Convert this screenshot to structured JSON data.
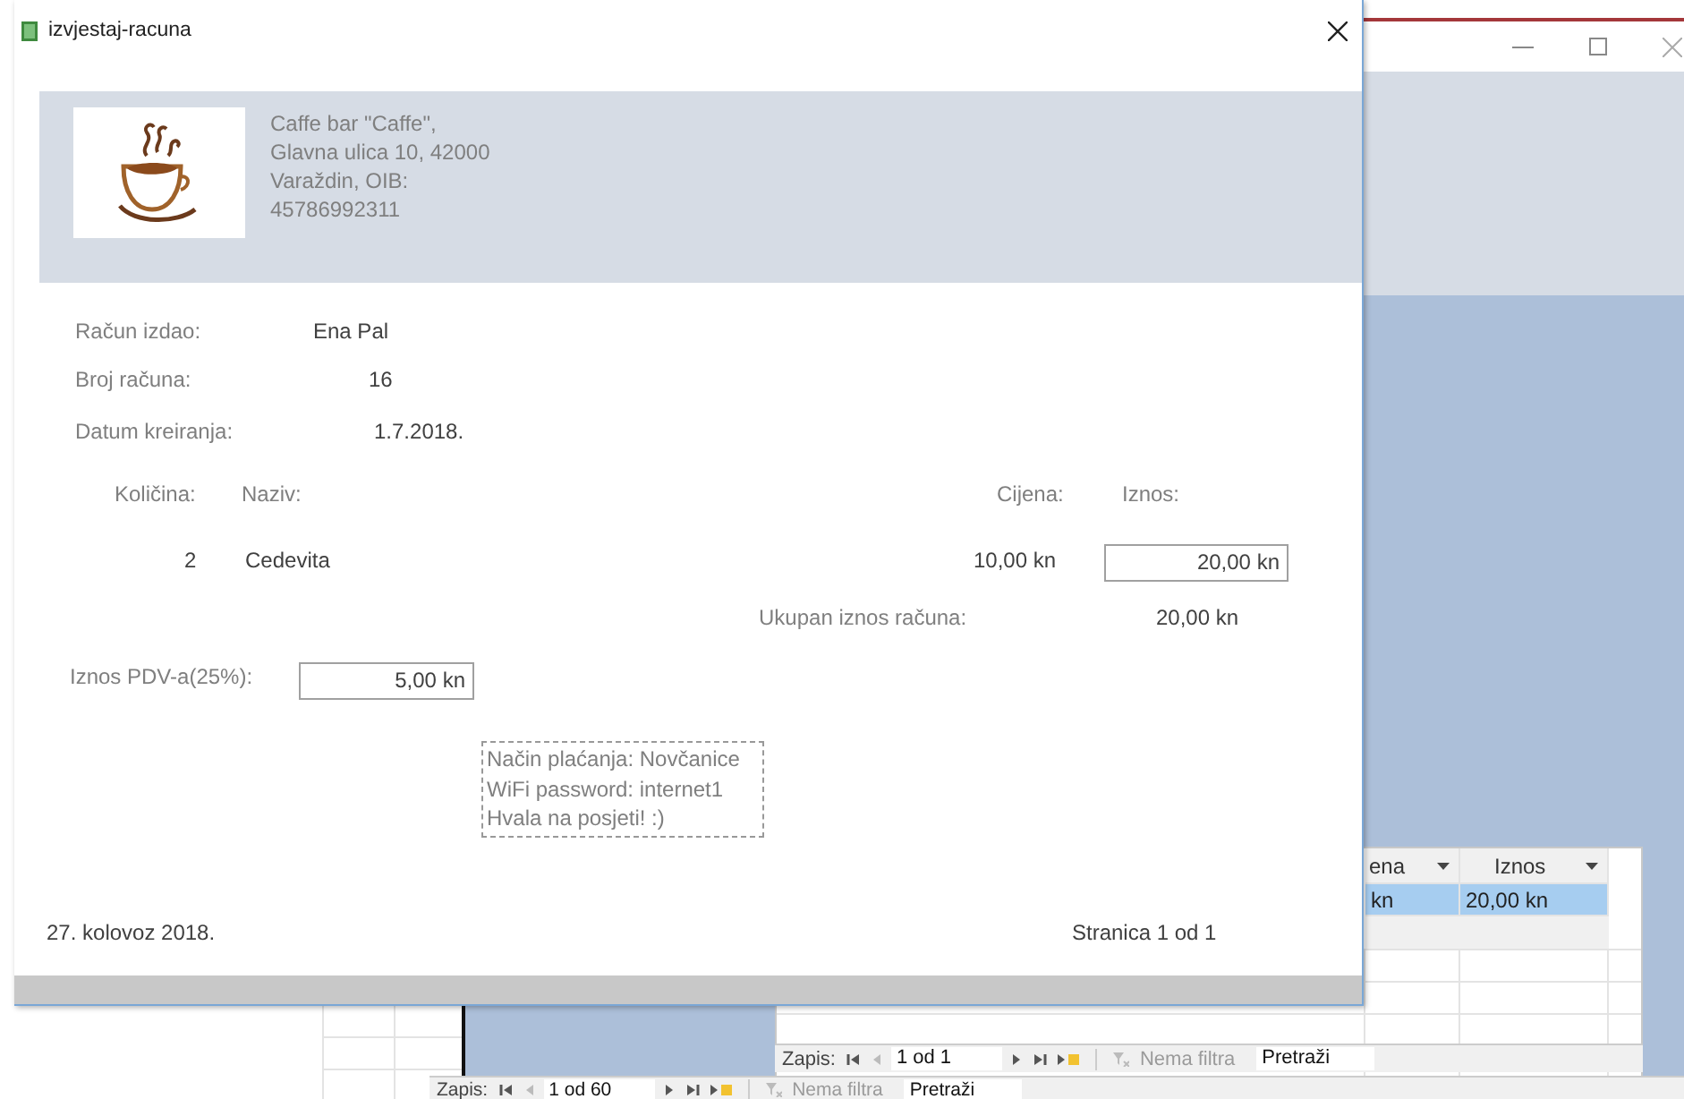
{
  "report": {
    "title": "izvjestaj-racuna",
    "company_lines": [
      "Caffe bar \"Caffe\",",
      "Glavna ulica 10, 42000",
      "Varaždin, OIB:",
      "45786992311"
    ],
    "fields": [
      {
        "label": "Račun izdao:",
        "value": "Ena Pal"
      },
      {
        "label": "Broj računa:",
        "value": "16"
      },
      {
        "label": "Datum kreiranja:",
        "value": "1.7.2018."
      }
    ],
    "columns": [
      "Količina:",
      "Naziv:",
      "Cijena:",
      "Iznos:"
    ],
    "items": [
      {
        "quantity": "2",
        "name": "Cedevita",
        "price": "10,00 kn",
        "amount": "20,00 kn"
      }
    ],
    "total": {
      "label": "Ukupan iznos računa:",
      "value": "20,00 kn"
    },
    "vat": {
      "label": "Iznos PDV-a(25%):",
      "value": "5,00 kn"
    },
    "note_lines": [
      "Način plaćanja: Novčanice",
      "WiFi password: internet1",
      "Hvala na posjeti! :)"
    ],
    "date": "27. kolovoz 2018.",
    "page": "Stranica 1 od 1"
  },
  "background_form": {
    "datasheet": {
      "columns": [
        "ena",
        "Iznos"
      ],
      "rows": [
        {
          "cells": [
            "kn",
            "20,00 kn"
          ],
          "selected": true
        }
      ]
    },
    "subform_nav": {
      "label": "Zapis:",
      "position": "1 od 1",
      "filter": "Nema filtra",
      "search": "Pretraži"
    },
    "form_nav": {
      "label": "Zapis:",
      "position": "1 od 60",
      "filter": "Nema filtra",
      "search": "Pretraži"
    }
  }
}
